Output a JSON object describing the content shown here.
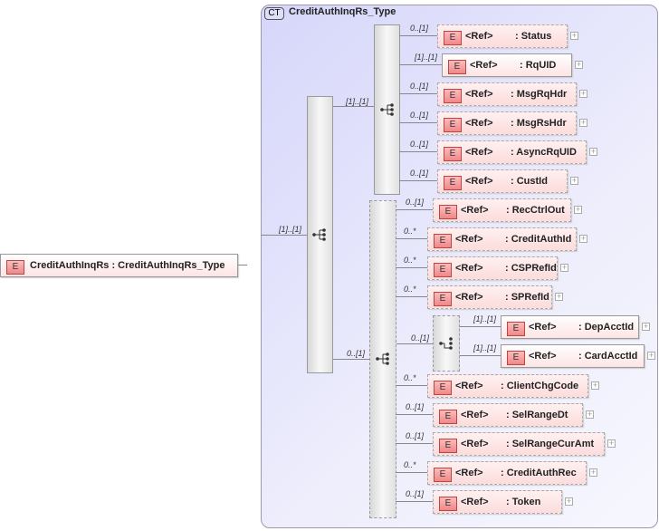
{
  "complex_type": {
    "badge": "CT",
    "name": "CreditAuthInqRs_Type"
  },
  "root": {
    "badge": "E",
    "label": "CreditAuthInqRs : CreditAuthInqRs_Type"
  },
  "outer_sequence": {
    "cardinality": "[1]..[1]"
  },
  "sequence1": {
    "cardinality": "[1]..[1]"
  },
  "sequence2": {
    "cardinality": "0..[1]"
  },
  "choice": {
    "cardinality": "0..[1]"
  },
  "ref_label": "<Ref>",
  "element_badge": "E",
  "elements": [
    {
      "name": ": Status",
      "card": "0..[1]",
      "optional": true
    },
    {
      "name": ": RqUID",
      "card": "[1]..[1]",
      "optional": false
    },
    {
      "name": ": MsgRqHdr",
      "card": "0..[1]",
      "optional": true
    },
    {
      "name": ": MsgRsHdr",
      "card": "0..[1]",
      "optional": true
    },
    {
      "name": ": AsyncRqUID",
      "card": "0..[1]",
      "optional": true
    },
    {
      "name": ": CustId",
      "card": "0..[1]",
      "optional": true
    },
    {
      "name": ": RecCtrlOut",
      "card": "0..[1]",
      "optional": true
    },
    {
      "name": ": CreditAuthId",
      "card": "0..*",
      "optional": true
    },
    {
      "name": ": CSPRefId",
      "card": "0..*",
      "optional": true
    },
    {
      "name": ": SPRefId",
      "card": "0..*",
      "optional": true
    },
    {
      "name": ": DepAcctId",
      "card": "[1]..[1]",
      "optional": false
    },
    {
      "name": ": CardAcctId",
      "card": "[1]..[1]",
      "optional": false
    },
    {
      "name": ": ClientChgCode",
      "card": "0..*",
      "optional": true
    },
    {
      "name": ": SelRangeDt",
      "card": "0..[1]",
      "optional": true
    },
    {
      "name": ": SelRangeCurAmt",
      "card": "0..[1]",
      "optional": true
    },
    {
      "name": ": CreditAuthRec",
      "card": "0..*",
      "optional": true
    },
    {
      "name": ": Token",
      "card": "0..[1]",
      "optional": true
    }
  ],
  "expand_symbol": "+"
}
